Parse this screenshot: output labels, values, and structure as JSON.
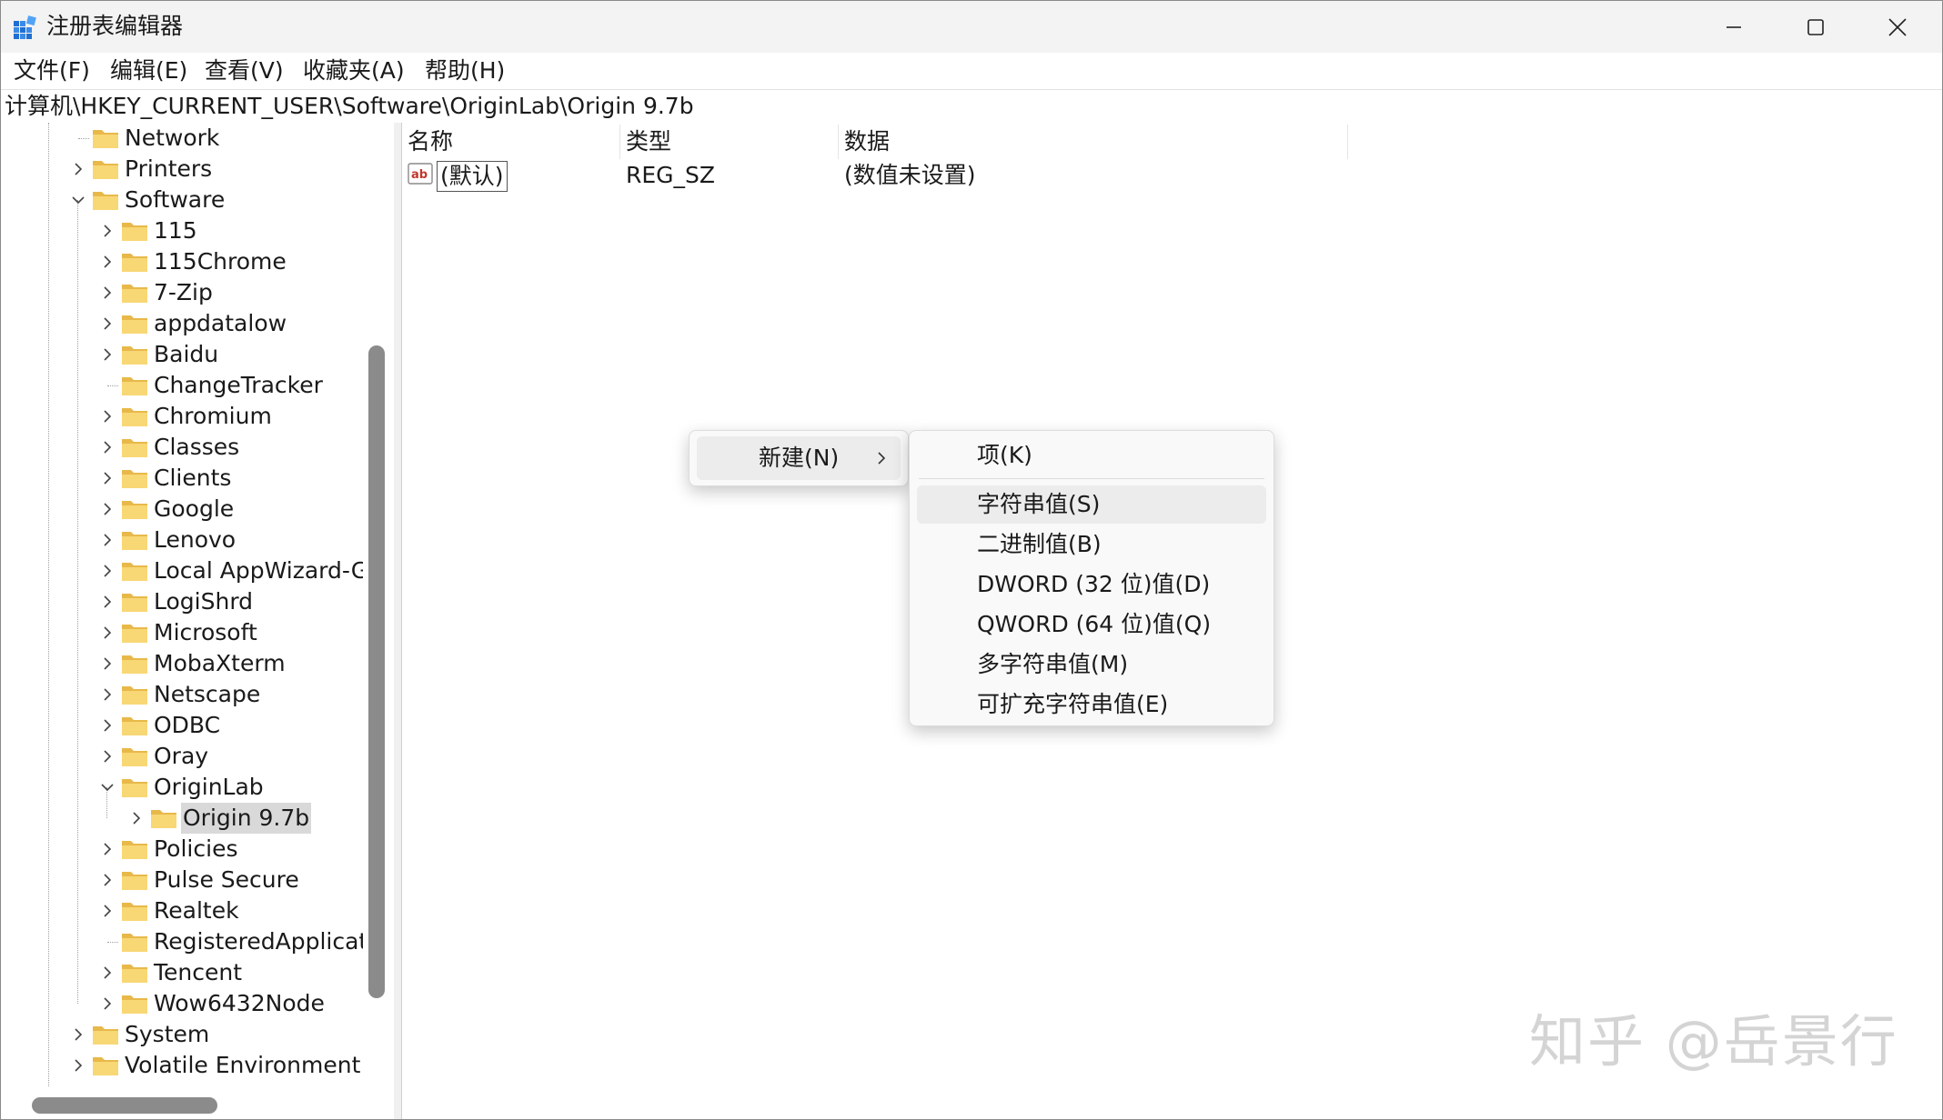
{
  "window": {
    "title": "注册表编辑器",
    "app_icon": "registry-editor-icon",
    "controls": {
      "minimize_icon": "minimize-icon",
      "maximize_icon": "maximize-icon",
      "close_icon": "close-icon"
    }
  },
  "menu": [
    {
      "label": "文件(F)"
    },
    {
      "label": "编辑(E)"
    },
    {
      "label": "查看(V)"
    },
    {
      "label": "收藏夹(A)"
    },
    {
      "label": "帮助(H)"
    }
  ],
  "address": "计算机\\HKEY_CURRENT_USER\\Software\\OriginLab\\Origin 9.7b",
  "tree": {
    "items": [
      {
        "label": "Network",
        "level": 1,
        "expander": "none"
      },
      {
        "label": "Printers",
        "level": 1,
        "expander": "collapsed"
      },
      {
        "label": "Software",
        "level": 1,
        "expander": "expanded"
      },
      {
        "label": "115",
        "level": 2,
        "expander": "collapsed"
      },
      {
        "label": "115Chrome",
        "level": 2,
        "expander": "collapsed"
      },
      {
        "label": "7-Zip",
        "level": 2,
        "expander": "collapsed"
      },
      {
        "label": "appdatalow",
        "level": 2,
        "expander": "collapsed"
      },
      {
        "label": "Baidu",
        "level": 2,
        "expander": "collapsed"
      },
      {
        "label": "ChangeTracker",
        "level": 2,
        "expander": "none"
      },
      {
        "label": "Chromium",
        "level": 2,
        "expander": "collapsed"
      },
      {
        "label": "Classes",
        "level": 2,
        "expander": "collapsed"
      },
      {
        "label": "Clients",
        "level": 2,
        "expander": "collapsed"
      },
      {
        "label": "Google",
        "level": 2,
        "expander": "collapsed"
      },
      {
        "label": "Lenovo",
        "level": 2,
        "expander": "collapsed"
      },
      {
        "label": "Local AppWizard-Ge",
        "level": 2,
        "expander": "collapsed"
      },
      {
        "label": "LogiShrd",
        "level": 2,
        "expander": "collapsed"
      },
      {
        "label": "Microsoft",
        "level": 2,
        "expander": "collapsed"
      },
      {
        "label": "MobaXterm",
        "level": 2,
        "expander": "collapsed"
      },
      {
        "label": "Netscape",
        "level": 2,
        "expander": "collapsed"
      },
      {
        "label": "ODBC",
        "level": 2,
        "expander": "collapsed"
      },
      {
        "label": "Oray",
        "level": 2,
        "expander": "collapsed"
      },
      {
        "label": "OriginLab",
        "level": 2,
        "expander": "expanded"
      },
      {
        "label": "Origin 9.7b",
        "level": 3,
        "expander": "collapsed",
        "selected": true
      },
      {
        "label": "Policies",
        "level": 2,
        "expander": "collapsed"
      },
      {
        "label": "Pulse Secure",
        "level": 2,
        "expander": "collapsed"
      },
      {
        "label": "Realtek",
        "level": 2,
        "expander": "collapsed"
      },
      {
        "label": "RegisteredApplicati",
        "level": 2,
        "expander": "none"
      },
      {
        "label": "Tencent",
        "level": 2,
        "expander": "collapsed"
      },
      {
        "label": "Wow6432Node",
        "level": 2,
        "expander": "collapsed"
      },
      {
        "label": "System",
        "level": 1,
        "expander": "collapsed"
      },
      {
        "label": "Volatile Environment",
        "level": 1,
        "expander": "collapsed"
      }
    ],
    "folder_color": "#f8d775"
  },
  "list": {
    "columns": {
      "name": "名称",
      "type": "类型",
      "data": "数据"
    },
    "rows": [
      {
        "icon": "string-value-icon",
        "name": "(默认)",
        "type": "REG_SZ",
        "data": "(数值未设置)"
      }
    ]
  },
  "context_menu": {
    "new_label": "新建(N)",
    "submenu": [
      {
        "label": "项(K)"
      },
      {
        "label": "字符串值(S)",
        "hover": true
      },
      {
        "label": "二进制值(B)"
      },
      {
        "label": "DWORD (32 位)值(D)"
      },
      {
        "label": "QWORD (64 位)值(Q)"
      },
      {
        "label": "多字符串值(M)"
      },
      {
        "label": "可扩充字符串值(E)"
      }
    ]
  },
  "watermark": "知乎 @岳景行"
}
